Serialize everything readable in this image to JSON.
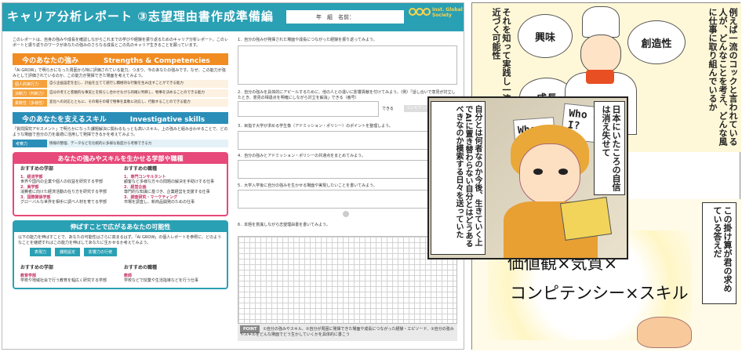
{
  "report": {
    "title": "キャリア分析レポート ③志望理由書作成準備編",
    "name_field": "年　組　名前：",
    "logo": "Inst. Global Society",
    "intro": "このレポートは、自身の強みや成長を確認しながらこれまでの学びや経験を振り返るためのキャリア分析レポート。このレポートと振り返りのワークがあなたの強みのさらなる成長とこの先のキャリア生きることを願っています。",
    "strengths_title": "今のあなたの強み",
    "strengths_en": "Strengths & Competencies",
    "strengths_desc": "「Ai GROW」で明らかになった周囲から特に評価されている能力。つまり、今のあなたの強みです。なぜ、この能力が強みとして評価されているのか、この能力が発揮できた場面を考えてみよう。",
    "strengths_rows": [
      {
        "k": "個人的実行力",
        "v": "自ら企画設定を出し、計画を立てて遂行し積極的な行動を生み出すことができる能力"
      },
      {
        "k": "決断力（判断力）",
        "v": "自分の考えと客観的な事実とを照らし合わせながら的確に判断し、物事を決めることのできる能力"
      },
      {
        "k": "柔軟性（多様性）",
        "v": "変化への対応とともに、その場その場で物事を柔軟に対応し、行動することのできる能力"
      }
    ],
    "skills_title": "今のあなたを支えるスキル",
    "skills_en": "Investigative skills",
    "skills_desc": "「質問探究アセスメント」で明らかになった課題解決に関わるもっとも高いスキル。上の強みと組み合わせることで、どのような場面で自分の力を最適に活用して発揮できるかを考えてみよう。",
    "skills_key": "考察力",
    "skills_val": "情報の整理、データなどを比較的に多様な角度から考察できる力",
    "fields_title": "あなたの強みやスキルを生かせる学部や職種",
    "rec_faculty": "おすすめの学部",
    "faculties": [
      "1．経済学部",
      "世界や国内の企業や個人の収益を研究する学部",
      "2．商学部",
      "消費者に向けた経済活動の在り方を研究する学部",
      "3．国際関係学部",
      "グローバルな世界を相手に調べ人材を育てる学部"
    ],
    "rec_job": "おすすめの職種",
    "jobs": [
      "1．専門コンサルタント",
      "顧客など多様な方々の問題の解決を手助けする仕事",
      "2．経営企画",
      "専門的な知識に基づき、企業経営を支援する仕事",
      "3．調査研究・マーケティング",
      "市場を調査し、新商品開発のための仕事"
    ],
    "growth_title": "伸ばすことで広がるあなたの可能性",
    "growth_desc": "以下の能力を伸ばすことで、あなたの可能性はさらに高まるはず。「Ai GROW」の個人レポートを参照に、どのようなことを継続すればこの能力を伸ばしてあなたに生かせるか考えてみよう。",
    "growth_chips": [
      "表現力",
      "課題設定",
      "影響力の行使"
    ],
    "growth_faculty": "教育学部",
    "growth_faculty_desc": "学校や地域社会で行う教育を幅広く研究する学部",
    "growth_job": "教師",
    "growth_job_desc": "学校などで授業や生活指導などを行う仕事",
    "q1": "1．自分の強みが発揮された場面や成長につながった経験を振り返ってみよう。",
    "q2": "2．自分の強みを具体的にアピールするために、他の人との違いに影響貢献を付けてみよう。（例）「話し合いで意見が対立したとき、意見の相違点を明確にしながら対立を解消」できる（番号）",
    "q2_suffix": "できる",
    "q2_btn": "コンピテンシー",
    "q3": "3．目指す大学が求める学生像（アドミッション・ポリシー）のポイントを整理しよう。",
    "q4": "4．自分の強みとアドミッション・ポリシーの共通点をまとめてみよう。",
    "q5": "5．大学入学後に自分の強みを生かせる場面や実現したいことを書いてみよう。",
    "q6": "6．本題を意識しながら志望理由書を書いてみよう。",
    "point_label": "POINT",
    "point_text": "①自分の強みやスキル、②自分が周囲に発揮できた場面や成長につながった経験・エピソード、③自分の強みやスキルをどんな場面でどう生かしていくかを具体的に書こう"
  },
  "manga": {
    "p1_text": "例えば一流のコックと言われている人が、どんなことを考え、どんな風に仕事に取り組んでいるか",
    "p1_text2": "それを知って実践し一流に近づく可能性",
    "bubbles": [
      "興味",
      "創造性",
      "成長"
    ],
    "p3_narr1": "日本にいたころの自信は消え失せて",
    "p3_narr2": "自分とは何者なのか今後、生きていく上でAIに置き替わらない自分とはどうあるべきなのか模索する日々を送っていた",
    "who1": "Who",
    "who2": "Who am I?",
    "p2_line1": "価値観×気質×",
    "p2_line2": "コンピテンシー×スキル",
    "p2_narr": "この掛け算が君の求めている答えだ"
  }
}
